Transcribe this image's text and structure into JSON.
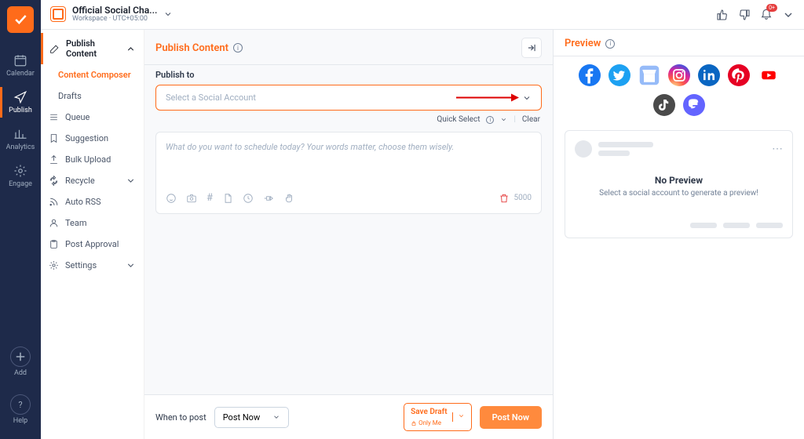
{
  "workspace": {
    "title": "Official Social Cha...",
    "subtitle": "Workspace · UTC+05:00"
  },
  "rail": {
    "calendar": "Calendar",
    "publish": "Publish",
    "analytics": "Analytics",
    "engage": "Engage",
    "add": "Add",
    "help": "Help"
  },
  "sidebar": {
    "header": "Publish Content",
    "items": {
      "composer": "Content Composer",
      "drafts": "Drafts",
      "queue": "Queue",
      "suggestion": "Suggestion",
      "bulk": "Bulk Upload",
      "recycle": "Recycle",
      "autorss": "Auto RSS",
      "team": "Team",
      "approval": "Post Approval",
      "settings": "Settings"
    }
  },
  "content": {
    "title": "Publish Content",
    "publish_to_label": "Publish to",
    "select_placeholder": "Select a Social Account",
    "quick_select": "Quick Select",
    "clear": "Clear",
    "editor_placeholder": "What do you want to schedule today? Your words matter, choose them wisely.",
    "char_count": "5000"
  },
  "footer": {
    "when_label": "When to post",
    "when_value": "Post Now",
    "save_draft": "Save Draft",
    "only_me": "Only Me",
    "post_now": "Post Now"
  },
  "preview": {
    "title": "Preview",
    "no_preview_title": "No Preview",
    "no_preview_sub": "Select a social account to generate a preview!"
  },
  "notif_count": "0+"
}
